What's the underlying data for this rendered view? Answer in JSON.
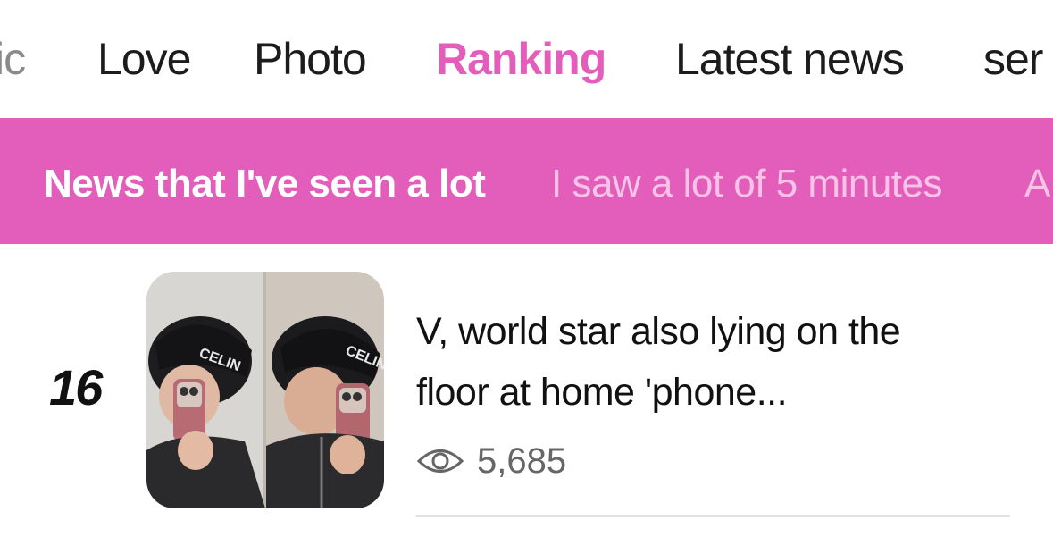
{
  "top_tabs": [
    {
      "label": "ic"
    },
    {
      "label": "Love"
    },
    {
      "label": "Photo"
    },
    {
      "label": "Ranking"
    },
    {
      "label": "Latest news"
    },
    {
      "label": "ser"
    }
  ],
  "sub_tabs": [
    {
      "label": "News that I've seen a lot"
    },
    {
      "label": "I saw a lot of 5 minutes"
    },
    {
      "label": "A"
    }
  ],
  "article": {
    "rank": "16",
    "title_line1": "V, world star also lying on the",
    "title_line2": "floor at home 'phone...",
    "views": "5,685",
    "thumbnail_cap_text": "CELIN"
  },
  "colors": {
    "accent": "#e35dbb",
    "sub_inactive": "#f7c3e6"
  }
}
